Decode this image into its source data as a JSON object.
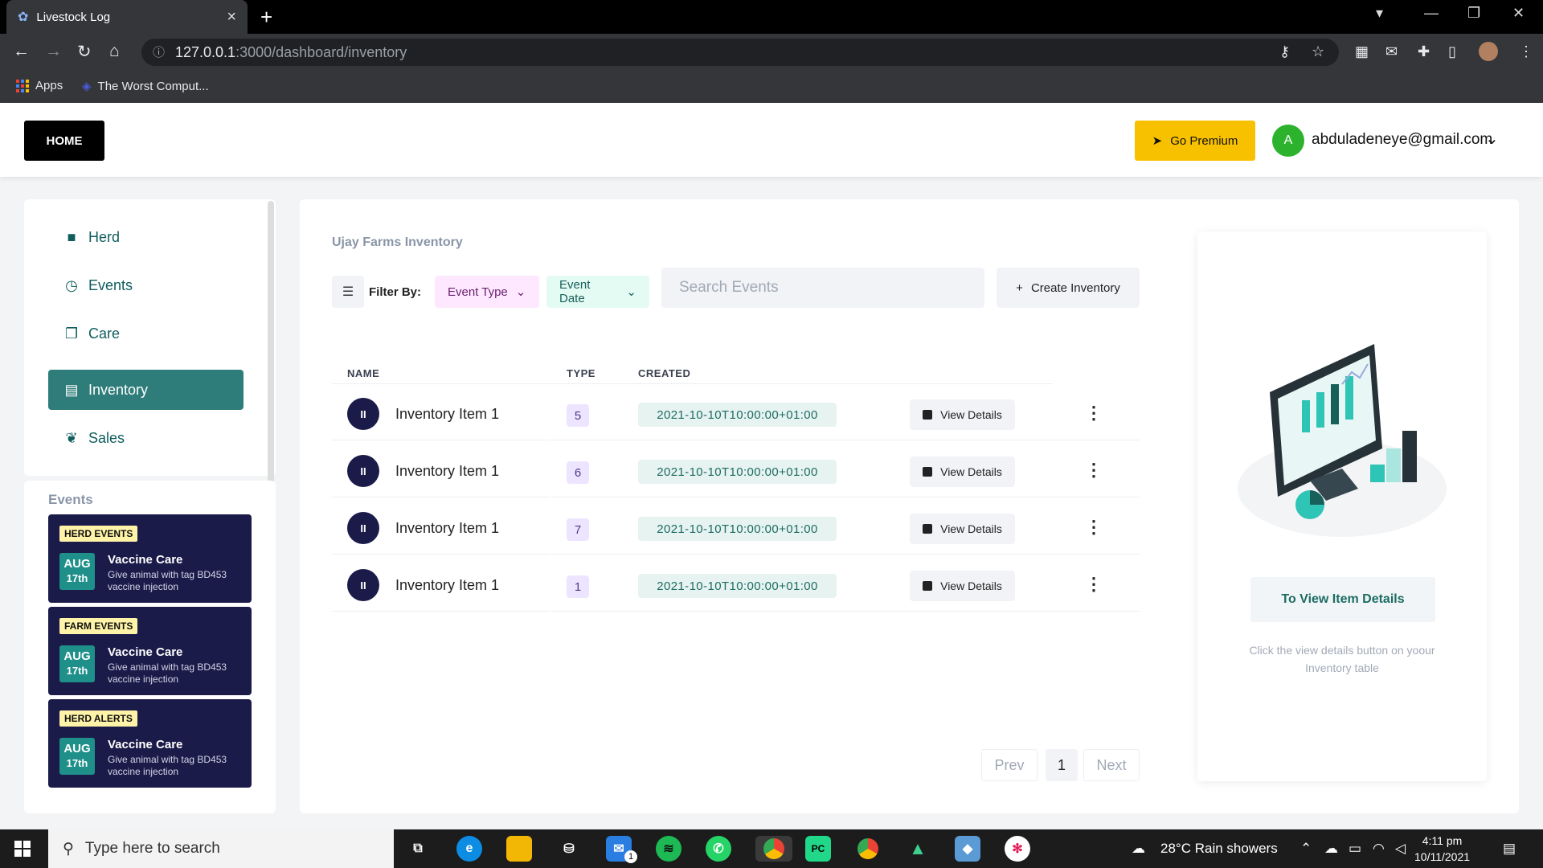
{
  "browser": {
    "tab_title": "Livestock Log",
    "url_host": "127.0.0.1",
    "url_path": ":3000/dashboard/inventory",
    "bookmarks": [
      "Apps",
      "The Worst Comput..."
    ]
  },
  "header": {
    "home_label": "HOME",
    "premium_label": "Go Premium",
    "avatar_initial": "A",
    "user_email": "abduladeneye@gmail.com"
  },
  "sidebar": {
    "items": [
      {
        "label": "Herd",
        "icon": "folder-icon"
      },
      {
        "label": "Events",
        "icon": "clock-icon"
      },
      {
        "label": "Care",
        "icon": "copy-icon"
      },
      {
        "label": "Inventory",
        "icon": "clipboard-icon"
      },
      {
        "label": "Sales",
        "icon": "leaf-icon"
      }
    ],
    "active": "Inventory"
  },
  "events": {
    "title": "Events",
    "cards": [
      {
        "tag": "HERD EVENTS",
        "month": "AUG",
        "day": "17th",
        "title": "Vaccine Care",
        "desc": "Give animal with tag BD453 vaccine injection"
      },
      {
        "tag": "FARM EVENTS",
        "month": "AUG",
        "day": "17th",
        "title": "Vaccine Care",
        "desc": "Give animal with tag BD453 vaccine injection"
      },
      {
        "tag": "HERD ALERTS",
        "month": "AUG",
        "day": "17th",
        "title": "Vaccine Care",
        "desc": "Give animal with tag BD453 vaccine injection"
      }
    ]
  },
  "inventory": {
    "title": "Ujay Farms Inventory",
    "filter_label": "Filter By:",
    "filter_type": "Event Type",
    "filter_date": "Event Date",
    "search_placeholder": "Search Events",
    "create_label": "Create Inventory",
    "columns": {
      "name": "NAME",
      "type": "TYPE",
      "created": "CREATED"
    },
    "rows": [
      {
        "initials": "II",
        "name": "Inventory Item 1",
        "type": "5",
        "created": "2021-10-10T10:00:00+01:00",
        "action": "View Details"
      },
      {
        "initials": "II",
        "name": "Inventory Item 1",
        "type": "6",
        "created": "2021-10-10T10:00:00+01:00",
        "action": "View Details"
      },
      {
        "initials": "II",
        "name": "Inventory Item 1",
        "type": "7",
        "created": "2021-10-10T10:00:00+01:00",
        "action": "View Details"
      },
      {
        "initials": "II",
        "name": "Inventory Item 1",
        "type": "1",
        "created": "2021-10-10T10:00:00+01:00",
        "action": "View Details"
      }
    ],
    "pagination": {
      "prev": "Prev",
      "page": "1",
      "next": "Next"
    }
  },
  "details": {
    "button": "To View Item Details",
    "hint": "Click the view details button on yoour Inventory table"
  },
  "taskbar": {
    "search_placeholder": "Type here to search",
    "weather": "28°C  Rain showers",
    "time": "4:11 pm",
    "date": "10/11/2021",
    "badge_mail": "1"
  },
  "colors": {
    "accent_teal": "#2e7d7a",
    "navy": "#1b1b4a",
    "premium_yellow": "#f8c100"
  }
}
